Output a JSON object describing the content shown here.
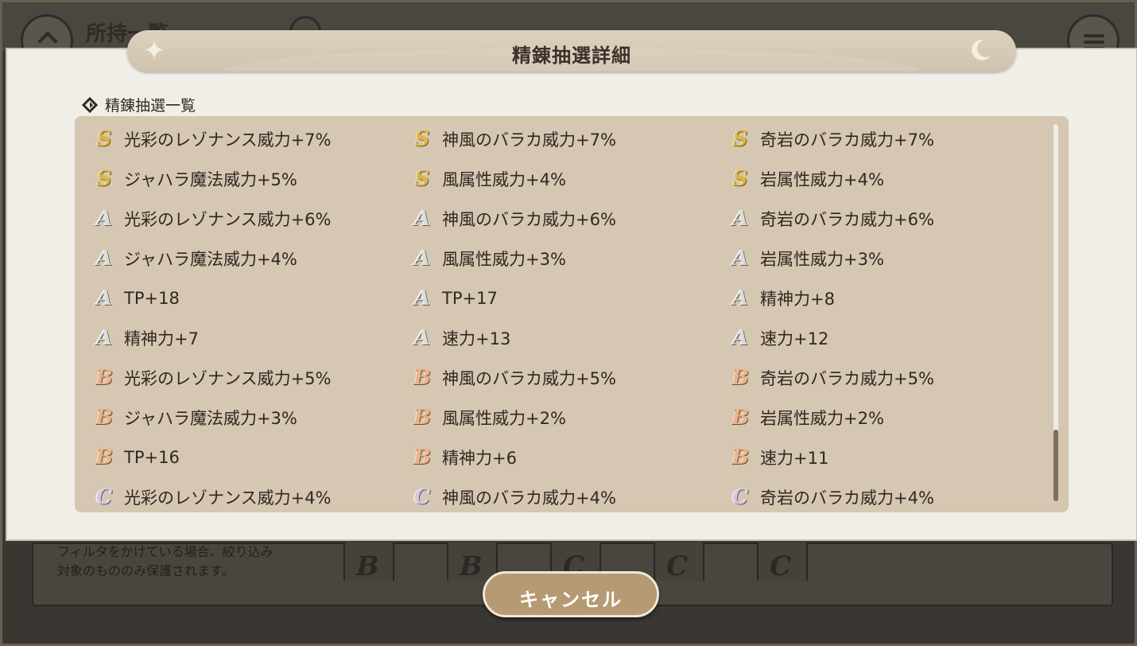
{
  "background": {
    "title": "所持一覧",
    "note_line1": "フィルタをかけている場合、絞り込み",
    "note_line2": "対象のもののみ保護されます。",
    "card_grades": [
      "B",
      "B",
      "C",
      "C",
      "C"
    ]
  },
  "modal": {
    "title": "精錬抽選詳細",
    "section_label": "精錬抽選一覧",
    "rows": [
      [
        {
          "grade": "S",
          "text": "光彩のレゾナンス威力+7%"
        },
        {
          "grade": "S",
          "text": "神風のバラカ威力+7%"
        },
        {
          "grade": "S",
          "text": "奇岩のバラカ威力+7%"
        }
      ],
      [
        {
          "grade": "S",
          "text": "ジャハラ魔法威力+5%"
        },
        {
          "grade": "S",
          "text": "風属性威力+4%"
        },
        {
          "grade": "S",
          "text": "岩属性威力+4%"
        }
      ],
      [
        {
          "grade": "A",
          "text": "光彩のレゾナンス威力+6%"
        },
        {
          "grade": "A",
          "text": "神風のバラカ威力+6%"
        },
        {
          "grade": "A",
          "text": "奇岩のバラカ威力+6%"
        }
      ],
      [
        {
          "grade": "A",
          "text": "ジャハラ魔法威力+4%"
        },
        {
          "grade": "A",
          "text": "風属性威力+3%"
        },
        {
          "grade": "A",
          "text": "岩属性威力+3%"
        }
      ],
      [
        {
          "grade": "A",
          "text": "TP+18"
        },
        {
          "grade": "A",
          "text": "TP+17"
        },
        {
          "grade": "A",
          "text": "精神力+8"
        }
      ],
      [
        {
          "grade": "A",
          "text": "精神力+7"
        },
        {
          "grade": "A",
          "text": "速力+13"
        },
        {
          "grade": "A",
          "text": "速力+12"
        }
      ],
      [
        {
          "grade": "B",
          "text": "光彩のレゾナンス威力+5%"
        },
        {
          "grade": "B",
          "text": "神風のバラカ威力+5%"
        },
        {
          "grade": "B",
          "text": "奇岩のバラカ威力+5%"
        }
      ],
      [
        {
          "grade": "B",
          "text": "ジャハラ魔法威力+3%"
        },
        {
          "grade": "B",
          "text": "風属性威力+2%"
        },
        {
          "grade": "B",
          "text": "岩属性威力+2%"
        }
      ],
      [
        {
          "grade": "B",
          "text": "TP+16"
        },
        {
          "grade": "B",
          "text": "精神力+6"
        },
        {
          "grade": "B",
          "text": "速力+11"
        }
      ],
      [
        {
          "grade": "C",
          "text": "光彩のレゾナンス威力+4%"
        },
        {
          "grade": "C",
          "text": "神風のバラカ威力+4%"
        },
        {
          "grade": "C",
          "text": "奇岩のバラカ威力+4%"
        }
      ]
    ],
    "cancel_label": "キャンセル"
  },
  "icons": {
    "sparkle": "sparkle-icon",
    "moon": "moon-icon",
    "section_marker": "diamond-arrow-icon"
  }
}
